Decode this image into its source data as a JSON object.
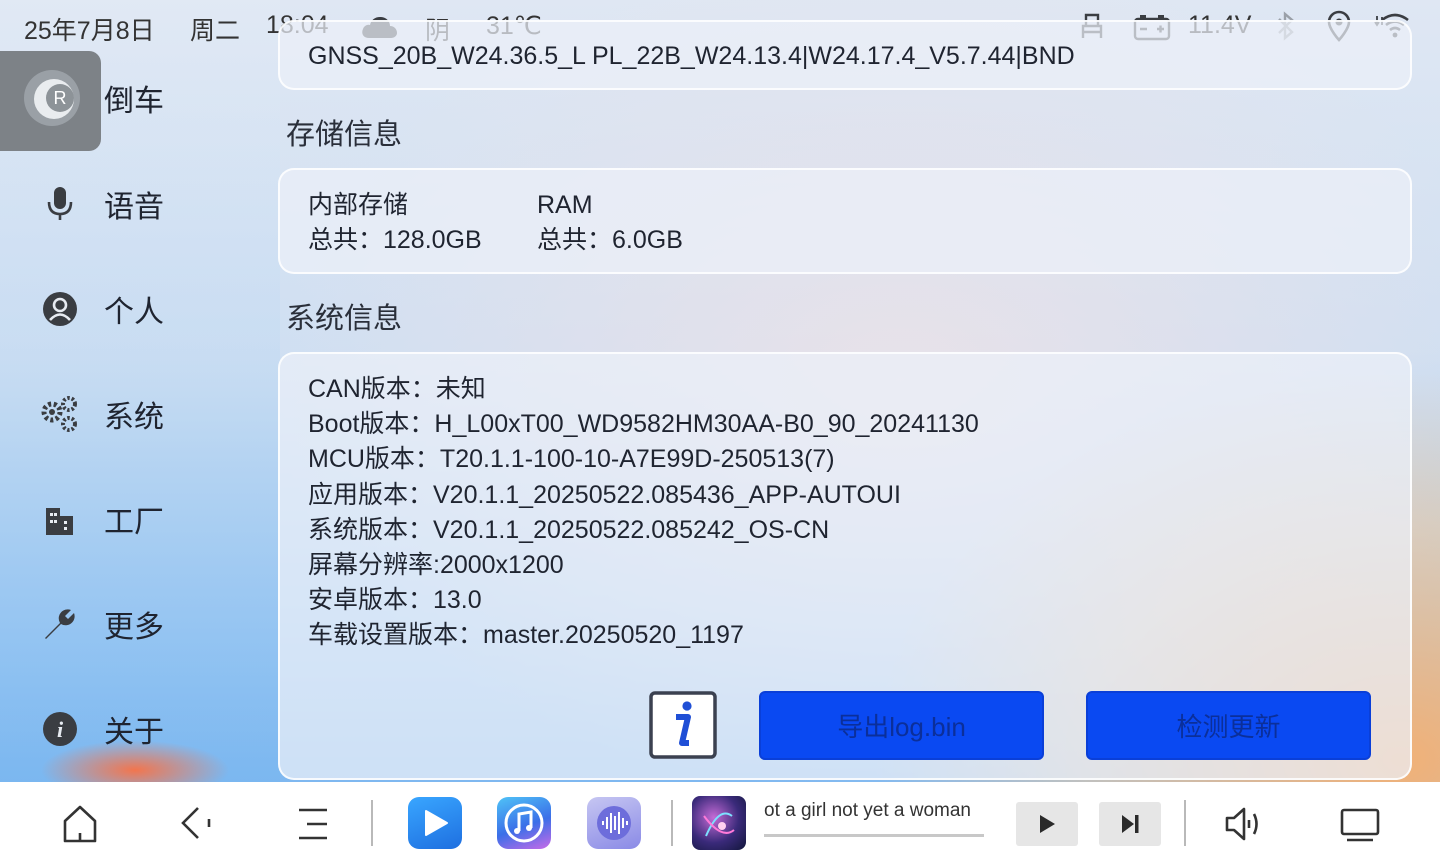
{
  "status_bar": {
    "date": "25年7月8日",
    "weekday": "周二",
    "time": "18:04",
    "weather_icon": "cloud-icon",
    "weather": "阴",
    "temperature": "31℃",
    "seat_icon": "seat-icon",
    "battery_icon": "car-battery-icon",
    "voltage": "11.4V",
    "bluetooth_icon": "bluetooth-icon",
    "location_icon": "location-icon",
    "wifi_icon": "wifi-icon"
  },
  "sidebar": {
    "items": [
      {
        "label": "倒车",
        "icon": "reverse-r-icon",
        "active": true
      },
      {
        "label": "语音",
        "icon": "microphone-icon",
        "active": false
      },
      {
        "label": "个人",
        "icon": "user-icon",
        "active": false
      },
      {
        "label": "系统",
        "icon": "gears-icon",
        "active": false
      },
      {
        "label": "工厂",
        "icon": "factory-icon",
        "active": false
      },
      {
        "label": "更多",
        "icon": "wrench-icon",
        "active": false
      },
      {
        "label": "关于",
        "icon": "info-icon",
        "active": false
      }
    ]
  },
  "content": {
    "gnss_partial": "GNSS_20B_W24.36.5_L PL_22B_W24.13.4|W24.17.4_V5.7.44|BND",
    "storage": {
      "title": "存储信息",
      "internal_label": "内部存储",
      "internal_total": "总共：128.0GB",
      "ram_label": "RAM",
      "ram_total": "总共：6.0GB"
    },
    "system": {
      "title": "系统信息",
      "lines": [
        "CAN版本：未知",
        "Boot版本：H_L00xT00_WD9582HM30AA-B0_90_20241130",
        "MCU版本：T20.1.1-100-10-A7E99D-250513(7)",
        "应用版本：V20.1.1_20250522.085436_APP-AUTOUI",
        "系统版本：V20.1.1_20250522.085242_OS-CN",
        "屏幕分辨率:2000x1200",
        "安卓版本：13.0",
        "车载设置版本：master.20250520_1197"
      ]
    },
    "buttons": {
      "info_icon": "info-i-icon",
      "export_log": "导出log.bin",
      "check_update": "检测更新"
    }
  },
  "taskbar": {
    "home_icon": "home-icon",
    "back_icon": "back-icon",
    "menu_icon": "menu-icon",
    "apps": [
      {
        "name": "video-player-app-icon",
        "color": "#2f8cf0"
      },
      {
        "name": "music-app-icon",
        "color": "#2ea0e8"
      },
      {
        "name": "voice-wave-app-icon",
        "color": "#8a8ae6"
      }
    ],
    "now_playing": {
      "title": "ot a girl not yet a woman",
      "progress": 0.0
    },
    "play_icon": "play-icon",
    "next_icon": "skip-next-icon",
    "volume_icon": "volume-icon",
    "screen_icon": "screen-icon"
  }
}
